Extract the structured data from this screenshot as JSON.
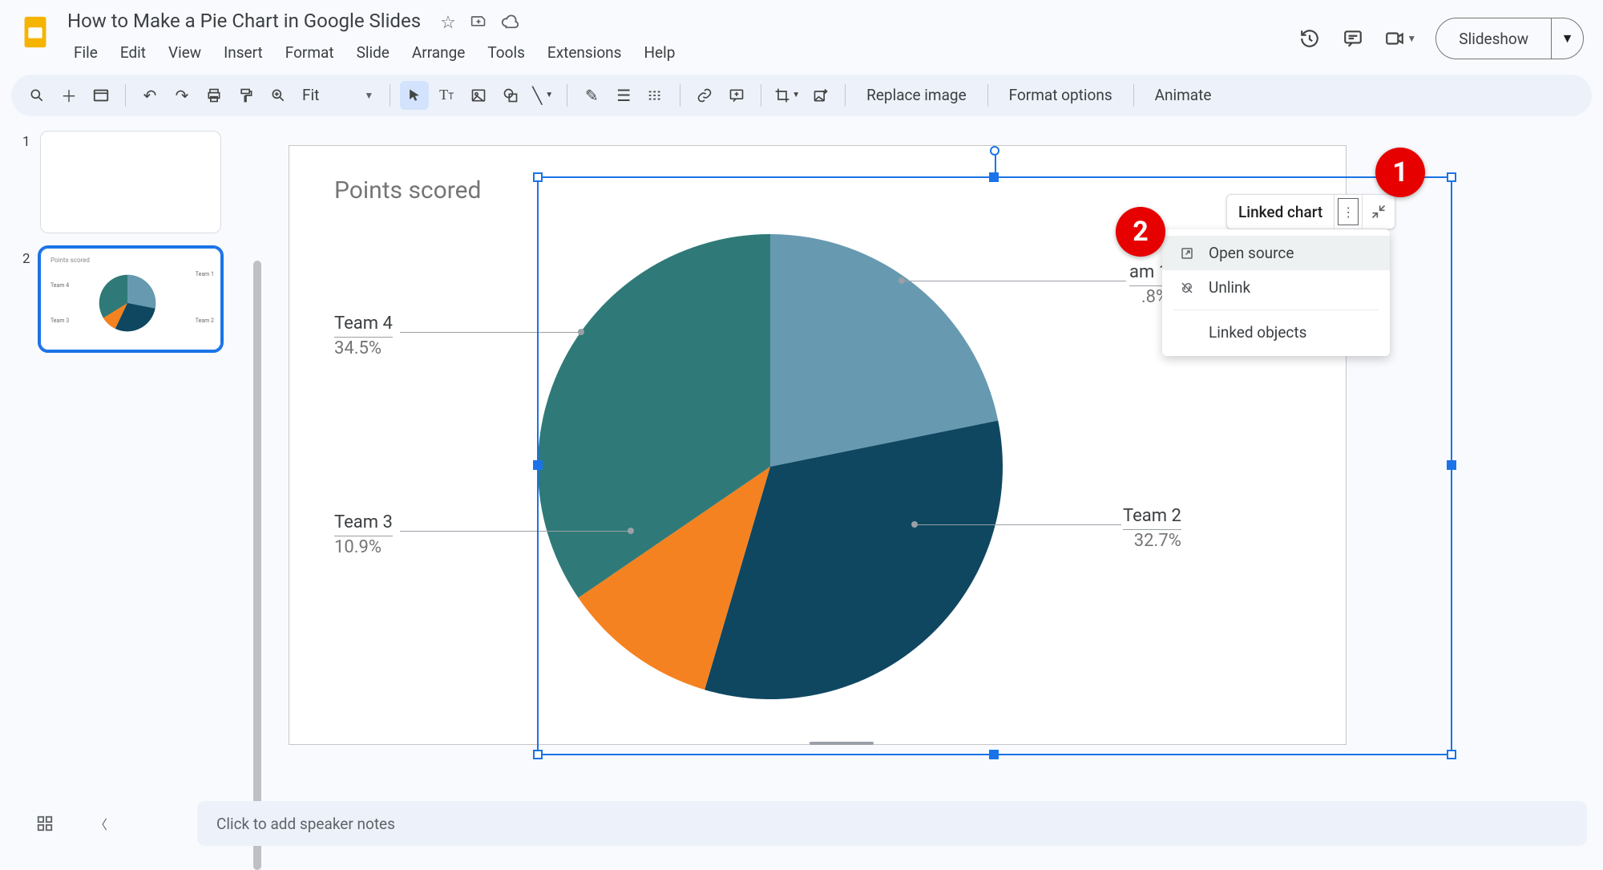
{
  "doc_title": "How to Make a Pie Chart in Google Slides",
  "menus": [
    "File",
    "Edit",
    "View",
    "Insert",
    "Format",
    "Slide",
    "Arrange",
    "Tools",
    "Extensions",
    "Help"
  ],
  "zoom_label": "Fit",
  "toolbar_texts": {
    "replace_image": "Replace image",
    "format_options": "Format options",
    "animate": "Animate"
  },
  "slideshow_label": "Slideshow",
  "slides": [
    {
      "number": "1",
      "selected": false
    },
    {
      "number": "2",
      "selected": true
    }
  ],
  "linked_bar_label": "Linked chart",
  "dropdown": {
    "open_source": "Open source",
    "unlink": "Unlink",
    "linked_objects": "Linked objects"
  },
  "speaker_notes_placeholder": "Click to add speaker notes",
  "annotations": {
    "one": "1",
    "two": "2"
  },
  "chart_data": {
    "type": "pie",
    "title": "Points scored",
    "series": [
      {
        "name": "Team 1",
        "value": 21.8,
        "pct": "21.8%",
        "color": "#679ab1",
        "label_visible": "am 1",
        "pct_visible": ".8%"
      },
      {
        "name": "Team 2",
        "value": 32.7,
        "pct": "32.7%",
        "color": "#0f4761"
      },
      {
        "name": "Team 3",
        "value": 10.9,
        "pct": "10.9%",
        "color": "#f58220"
      },
      {
        "name": "Team 4",
        "value": 34.5,
        "pct": "34.5%",
        "color": "#2f7a78"
      }
    ],
    "start_angle_deg": 0
  }
}
